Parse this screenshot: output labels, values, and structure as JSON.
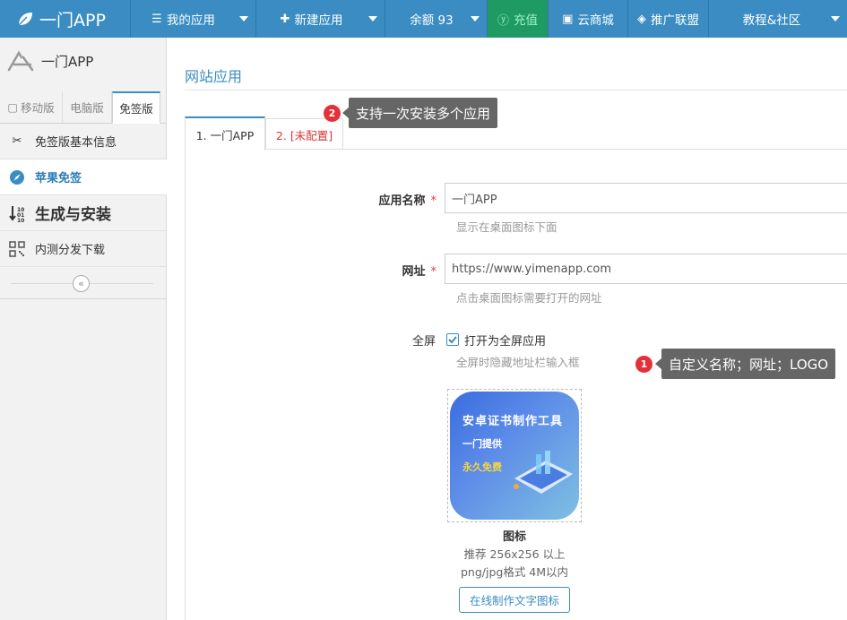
{
  "brand": {
    "title": "一门APP"
  },
  "nav": {
    "my_apps": "我的应用",
    "new_app": "新建应用",
    "balance": "余额 93",
    "recharge": "充值",
    "cloud_store": "云商城",
    "promo": "推广联盟",
    "tutorial": "教程&社区"
  },
  "sidebar": {
    "header": "一门APP",
    "tabs": [
      "移动版",
      "电脑版",
      "免签版"
    ],
    "items": [
      {
        "label": "免签版基本信息",
        "icon": "scissors-icon"
      },
      {
        "label": "苹果免签",
        "icon": "compass-icon"
      },
      {
        "label": "生成与安装",
        "icon": "sort-icon"
      },
      {
        "label": "内测分发下载",
        "icon": "qrcode-icon"
      }
    ]
  },
  "main": {
    "title": "网站应用",
    "tabs": [
      "1. 一门APP",
      "2. [未配置]"
    ],
    "form": {
      "name_label": "应用名称",
      "name_value": "一门APP",
      "name_hint": "显示在桌面图标下面",
      "url_label": "网址",
      "url_value": "https://www.yimenapp.com",
      "url_hint": "点击桌面图标需要打开的网址",
      "fullscreen_label": "全屏",
      "fullscreen_checkbox": "打开为全屏应用",
      "fullscreen_hint": "全屏时隐藏地址栏输入框",
      "required_mark": "*",
      "icon_label": "图标",
      "icon_hint1": "推荐 256x256 以上",
      "icon_hint2": "png/jpg格式 4M以内",
      "make_icon_button": "在线制作文字图标",
      "icon_text1": "安卓证书制作工具",
      "icon_text2": "一门提供",
      "icon_text3": "永久免费"
    }
  },
  "callouts": {
    "c1_badge": "1",
    "c1_text": "自定义名称；网址；LOGO",
    "c2_badge": "2",
    "c2_text": "支持一次安装多个应用"
  },
  "colors": {
    "primary": "#3a8cc2",
    "recharge_bg": "#1f9a63",
    "badge": "#e5303a",
    "required": "#e33333"
  }
}
